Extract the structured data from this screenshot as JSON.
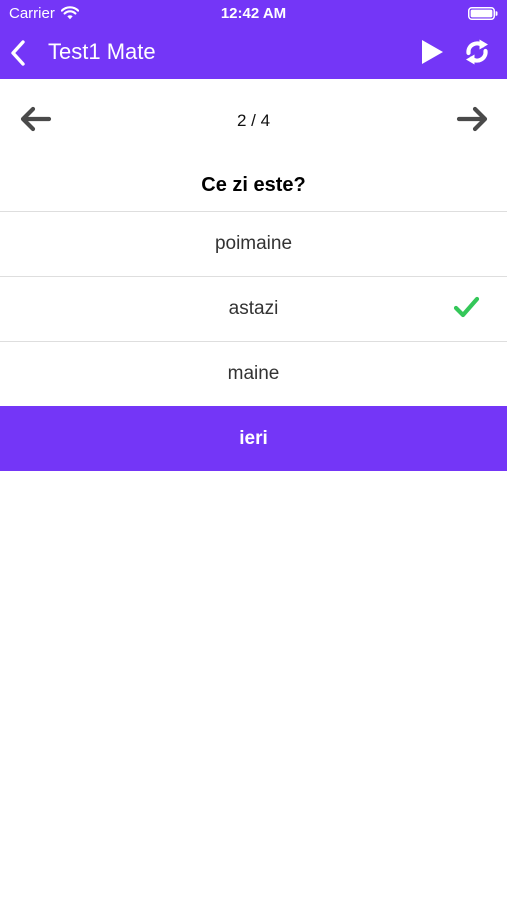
{
  "status_bar": {
    "carrier": "Carrier",
    "time": "12:42 AM",
    "icons": [
      "wifi-icon",
      "battery-icon"
    ]
  },
  "nav": {
    "title": "Test1 Mate",
    "icons": [
      "back-icon",
      "play-icon",
      "refresh-icon"
    ]
  },
  "pager": {
    "indicator": "2 / 4",
    "icons": [
      "arrow-left-icon",
      "arrow-right-icon"
    ]
  },
  "quiz": {
    "question": "Ce zi este?",
    "answers": [
      {
        "label": "poimaine",
        "state": "default"
      },
      {
        "label": "astazi",
        "state": "correct"
      },
      {
        "label": "maine",
        "state": "default"
      },
      {
        "label": "ieri",
        "state": "selected"
      }
    ]
  },
  "colors": {
    "accent": "#7436f7",
    "correct": "#34c759",
    "arrow": "#4a4a4a",
    "divider": "#dedede"
  }
}
